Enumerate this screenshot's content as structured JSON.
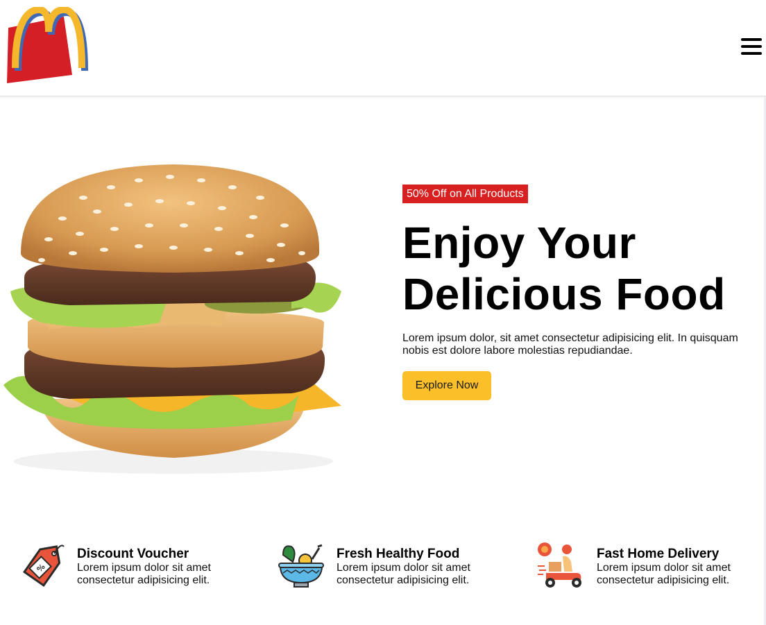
{
  "header": {
    "logo_icon": "mcdonalds-arches-logo",
    "menu_icon": "hamburger-menu-icon"
  },
  "hero": {
    "badge": "50% Off on All Products",
    "title": "Enjoy Your Delicious Food",
    "description": "Lorem ipsum dolor, sit amet consectetur adipisicing elit. In quisquam nobis est dolore labore molestias repudiandae.",
    "button_label": "Explore Now",
    "image": "big-mac-burger"
  },
  "features": [
    {
      "icon": "discount-tag-icon",
      "title": "Discount Voucher",
      "text": "Lorem ipsum dolor sit amet consectetur adipisicing elit."
    },
    {
      "icon": "healthy-food-bowl-icon",
      "title": "Fresh Healthy Food",
      "text": "Lorem ipsum dolor sit amet consectetur adipisicing elit."
    },
    {
      "icon": "delivery-scooter-icon",
      "title": "Fast Home Delivery",
      "text": "Lorem ipsum dolor sit amet consectetur adipisicing elit."
    }
  ],
  "colors": {
    "accent_yellow": "#fbbf2a",
    "badge_red": "#d7201f",
    "logo_red": "#d41f26",
    "logo_yellow": "#f5b72c"
  }
}
